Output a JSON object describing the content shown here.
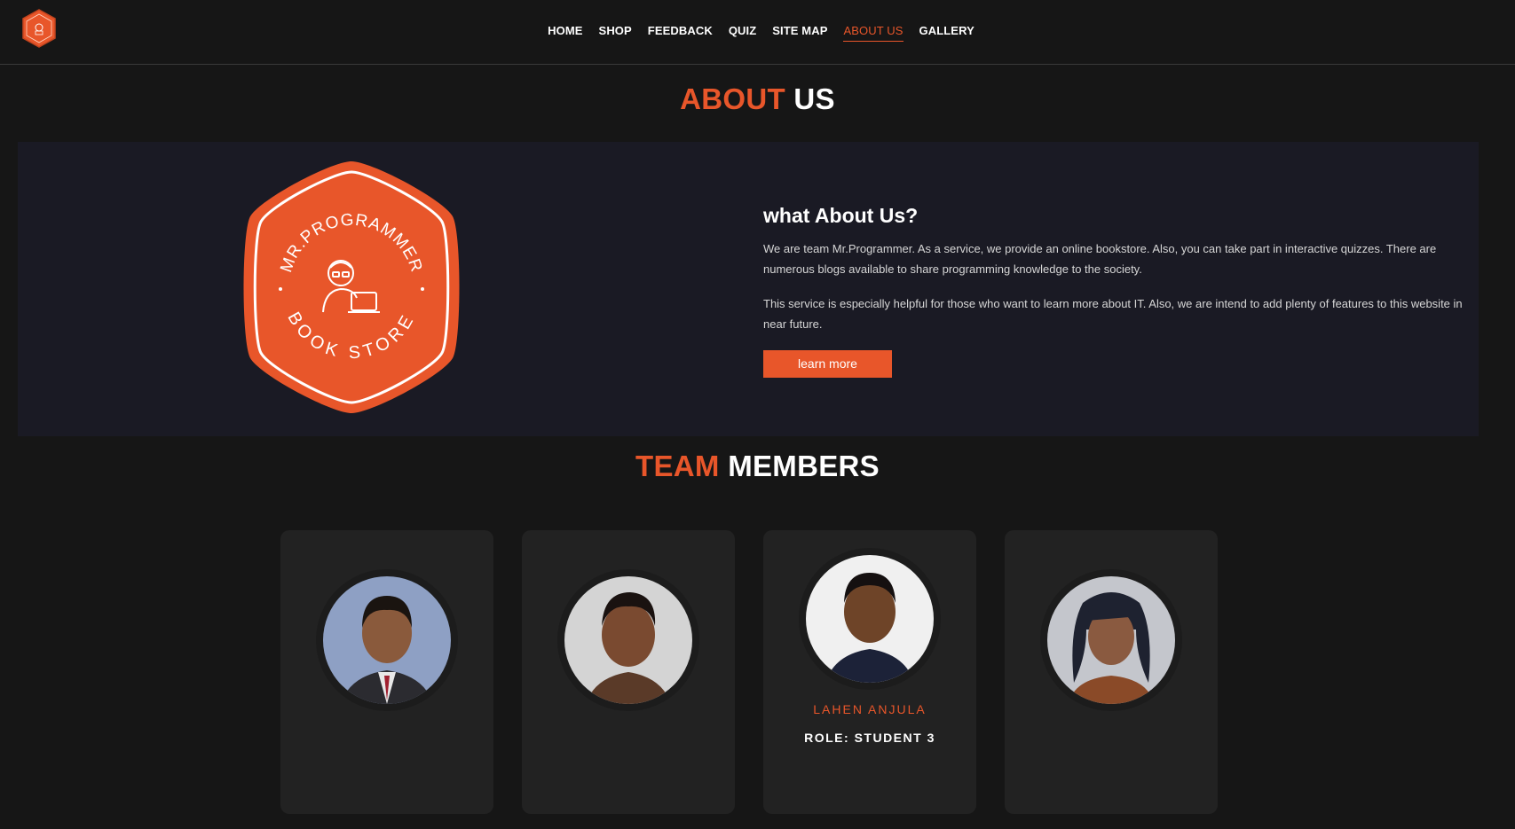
{
  "nav": {
    "items": [
      {
        "label": "HOME"
      },
      {
        "label": "SHOP"
      },
      {
        "label": "FEEDBACK"
      },
      {
        "label": "QUIZ"
      },
      {
        "label": "SITE MAP"
      },
      {
        "label": "ABOUT US",
        "active": true
      },
      {
        "label": "GALLERY"
      }
    ]
  },
  "about": {
    "title_accent": "ABOUT",
    "title_rest": "US",
    "heading": "what About Us?",
    "paragraph1": "We are team Mr.Programmer. As a service, we provide an online bookstore. Also, you can take part in interactive quizzes. There are numerous blogs available to share programming knowledge to the society.",
    "paragraph2": "This service is especially helpful for those who want to learn more about IT. Also, we are intend to add plenty of features to this website in near future.",
    "button_label": "learn more",
    "badge_text_top": "MR.PROGRAMMER",
    "badge_text_bottom": "BOOK STORE"
  },
  "team": {
    "title_accent": "TEAM",
    "title_rest": "MEMBERS",
    "members": [
      {
        "photo": "member-photo-1",
        "name": "",
        "role": ""
      },
      {
        "photo": "member-photo-2",
        "name": "",
        "role": ""
      },
      {
        "photo": "member-photo-3",
        "name": "LAHEN ANJULA",
        "role": "ROLE: STUDENT 3"
      },
      {
        "photo": "member-photo-4",
        "name": "",
        "role": ""
      }
    ]
  },
  "colors": {
    "accent": "#e8562a",
    "background": "#161616",
    "panel": "#1a1a24",
    "card": "#222222"
  }
}
